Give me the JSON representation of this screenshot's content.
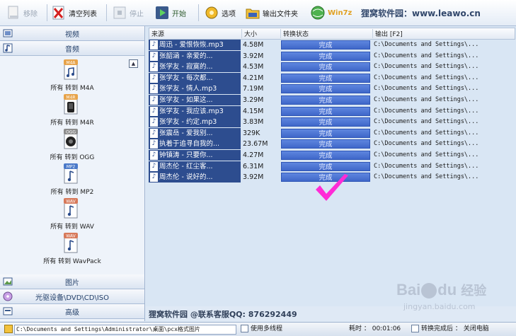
{
  "toolbar": {
    "remove_label": "移除",
    "clear_label": "清空列表",
    "stop_label": "停止",
    "start_label": "开始",
    "options_label": "选项",
    "output_folder_label": "输出文件夹",
    "win7_label": "Win7z",
    "brand_text": "狸窝软件园：www.leawo.cn"
  },
  "sidebar": {
    "video_label": "视频",
    "audio_label": "音频",
    "image_label": "图片",
    "disc_label": "光驱设备\\DVD\\CD\\ISO",
    "advanced_label": "高级",
    "formats": [
      {
        "badge": "M4A",
        "label": "所有 转到 M4A"
      },
      {
        "badge": "M4R",
        "label": "所有 转到 M4R"
      },
      {
        "badge": "OGG",
        "label": "所有 转到 OGG"
      },
      {
        "badge": "MP2",
        "label": "所有 转到 MP2"
      },
      {
        "badge": "WAV",
        "label": "所有 转到 WAV"
      },
      {
        "badge": "WAV",
        "label": "所有 转到 WavPack"
      }
    ]
  },
  "table": {
    "headers": {
      "source": "来源",
      "size": "大小",
      "status": "转换状态",
      "output": "输出 [F2]"
    },
    "rows": [
      {
        "source": "周迅 - 爱恨恢恢.mp3",
        "size": "4.58M",
        "status": "完成",
        "output": "C:\\Documents and Settings\\..."
      },
      {
        "source": "张韶涵 - 亲爱的...",
        "size": "3.92M",
        "status": "完成",
        "output": "C:\\Documents and Settings\\..."
      },
      {
        "source": "张学友 - 寂寞的...",
        "size": "4.53M",
        "status": "完成",
        "output": "C:\\Documents and Settings\\..."
      },
      {
        "source": "张学友 - 每次都...",
        "size": "4.21M",
        "status": "完成",
        "output": "C:\\Documents and Settings\\..."
      },
      {
        "source": "张学友 - 情人.mp3",
        "size": "7.19M",
        "status": "完成",
        "output": "C:\\Documents and Settings\\..."
      },
      {
        "source": "张学友 - 如果这...",
        "size": "3.29M",
        "status": "完成",
        "output": "C:\\Documents and Settings\\..."
      },
      {
        "source": "张学友 - 我应该.mp3",
        "size": "4.15M",
        "status": "完成",
        "output": "C:\\Documents and Settings\\..."
      },
      {
        "source": "张学友 - 约定.mp3",
        "size": "3.83M",
        "status": "完成",
        "output": "C:\\Documents and Settings\\..."
      },
      {
        "source": "张震岳 - 爱我别...",
        "size": "329K",
        "status": "完成",
        "output": "C:\\Documents and Settings\\..."
      },
      {
        "source": "执着于追寻自我的...",
        "size": "23.67M",
        "status": "完成",
        "output": "C:\\Documents and Settings\\..."
      },
      {
        "source": "钟镇涛 - 只要你...",
        "size": "4.27M",
        "status": "完成",
        "output": "C:\\Documents and Settings\\..."
      },
      {
        "source": "周杰伦 - 红尘客...",
        "size": "6.31M",
        "status": "完成",
        "output": "C:\\Documents and Settings\\..."
      },
      {
        "source": "周杰伦 - 说好的...",
        "size": "3.92M",
        "status": "完成",
        "output": "C:\\Documents and Settings\\..."
      }
    ]
  },
  "contact_text": "狸窝软件园 @联系客服QQ: 876292449",
  "statusbar": {
    "output_path": "C:\\Documents and Settings\\Administrator\\桌面\\pcx格式图片",
    "multithread_label": "使用多线程",
    "time_label": "耗时 ： 00:01:06",
    "after_label": "转换完成后 ： 关闭电脑"
  },
  "watermark": {
    "brand": "Bai",
    "brand2": "du",
    "word": "经验",
    "url": "jingyan.baidu.com"
  },
  "colors": {
    "selected_row": "#2d4d8f",
    "status_fill": "#4a72d4",
    "checkmark": "#ff2bd6",
    "brand_text": "#31476b"
  }
}
